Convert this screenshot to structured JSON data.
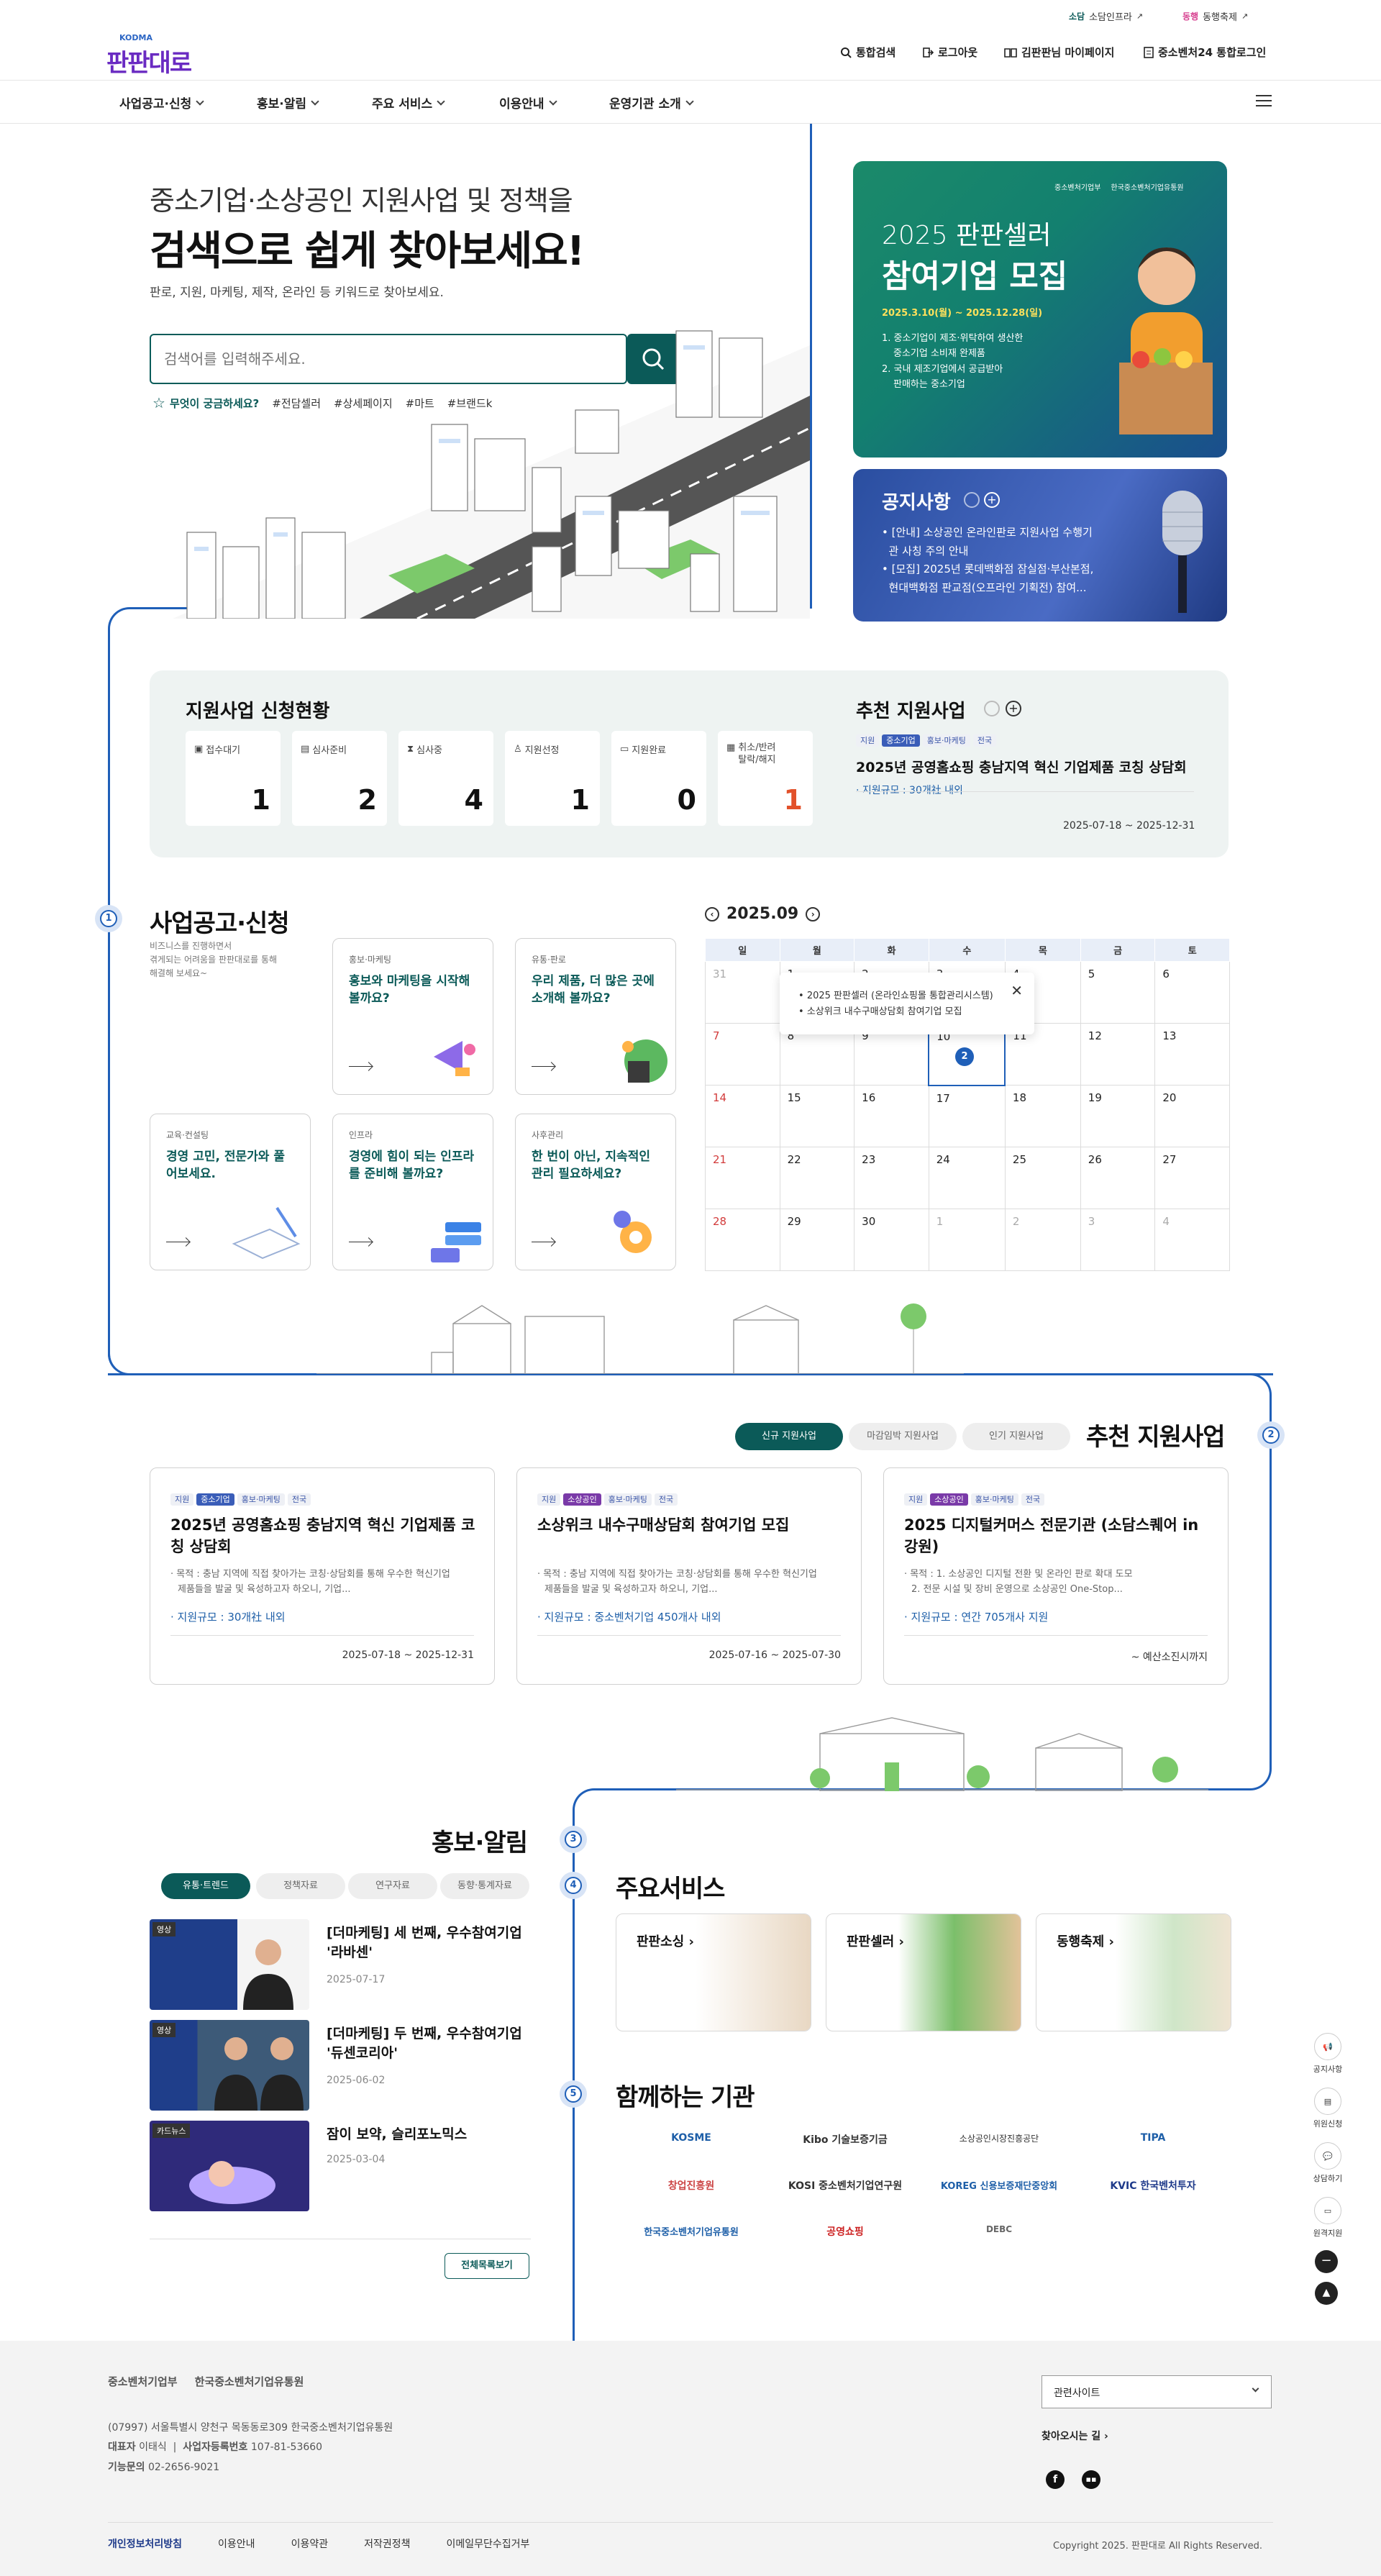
{
  "topbar": {
    "link1": "소담인프라",
    "link2": "동행축제"
  },
  "header": {
    "logo_top": "KODMA",
    "logo": "판판대로",
    "search": "통합검색",
    "logout": "로그아웃",
    "mypage": "김판판님 마이페이지",
    "login24": "중소벤처24 통합로그인"
  },
  "gnb": [
    "사업공고·신청",
    "홍보·알림",
    "주요 서비스",
    "이용안내",
    "운영기관 소개"
  ],
  "hero": {
    "sub": "중소기업·소상공인 지원사업 및 정책을",
    "title": "검색으로 쉽게 찾아보세요!",
    "desc": "판로, 지원, 마케팅, 제작, 온라인 등 키워드로 찾아보세요.",
    "placeholder": "검색어를 입력해주세요.",
    "question": "무엇이 궁금하세요?",
    "keywords": [
      "#전담셀러",
      "#상세페이지",
      "#마트",
      "#브랜드k"
    ]
  },
  "banner1": {
    "org1": "중소벤처기업부",
    "org2": "한국중소벤처기업유통원",
    "year": "2025 판판셀러",
    "title": "참여기업 모집",
    "date": "2025.3.10(월) ~ 2025.12.28(일)",
    "l1": "1. 중소기업이 제조·위탁하여 생산한",
    "l1b": "중소기업 소비재 완제품",
    "l2": "2. 국내 제조기업에서 공급받아",
    "l2b": "판매하는 중소기업"
  },
  "notice": {
    "title": "공지사항",
    "i1a": "[안내] 소상공인 온라인판로 지원사업 수행기",
    "i1b": "관 사칭 주의 안내",
    "i2a": "[모집] 2025년 롯데백화점 잠실점·부산본점,",
    "i2b": "현대백화점 판교점(오프라인 기획전) 참여..."
  },
  "status": {
    "title": "지원사업 신청현황",
    "items": [
      {
        "label": "접수대기",
        "value": "1"
      },
      {
        "label": "심사준비",
        "value": "2"
      },
      {
        "label": "심사중",
        "value": "4"
      },
      {
        "label": "지원선정",
        "value": "1"
      },
      {
        "label": "지원완료",
        "value": "0"
      },
      {
        "label": "취소/반려",
        "label2": "탈락/해지",
        "value": "1"
      }
    ]
  },
  "rec_small": {
    "title": "추천 지원사업",
    "tags": [
      "지원",
      "중소기업",
      "홍보·마케팅",
      "전국"
    ],
    "item": "2025년 공영홈쇼핑 충남지역 혁신 기업제품 코칭 상담회",
    "scale": "· 지원규모 : 30개社 내외",
    "date": "2025-07-18 ~ 2025-12-31"
  },
  "biz": {
    "title": "사업공고·신청",
    "desc1": "비즈니스를 진행하면서",
    "desc2": "겪게되는 어려움을 판판대로를 통해",
    "desc3": "해결해 보세요~",
    "cards": [
      {
        "cat": "홍보·마케팅",
        "title": "홍보와 마케팅을 시작해 볼까요?"
      },
      {
        "cat": "유통·판로",
        "title": "우리 제품, 더 많은 곳에 소개해 볼까요?"
      },
      {
        "cat": "교육·컨설팅",
        "title": "경영 고민, 전문가와 풀어보세요."
      },
      {
        "cat": "인프라",
        "title": "경영에 힘이 되는 인프라를 준비해 볼까요?"
      },
      {
        "cat": "사후관리",
        "title": "한 번이 아닌, 지속적인 관리 필요하세요?"
      }
    ]
  },
  "calendar": {
    "month": "2025.09",
    "days": [
      "일",
      "월",
      "화",
      "수",
      "목",
      "금",
      "토"
    ],
    "weeks": [
      [
        "31",
        "1",
        "2",
        "3",
        "4",
        "5",
        "6"
      ],
      [
        "7",
        "8",
        "9",
        "10",
        "11",
        "12",
        "13"
      ],
      [
        "14",
        "15",
        "16",
        "17",
        "18",
        "19",
        "20"
      ],
      [
        "21",
        "22",
        "23",
        "24",
        "25",
        "26",
        "27"
      ],
      [
        "28",
        "29",
        "30",
        "1",
        "2",
        "3",
        "4"
      ]
    ],
    "popup1": "2025 판판셀러 (온라인쇼핑몰 통합관리시스템)",
    "popup2": "소상위크 내수구매상담회 참여기업 모집",
    "badge": "2"
  },
  "recommend": {
    "title": "추천 지원사업",
    "tabs": [
      "신규 지원사업",
      "마감임박 지원사업",
      "인기 지원사업"
    ],
    "cards": [
      {
        "tags": [
          "지원",
          "중소기업",
          "홍보·마케팅",
          "전국"
        ],
        "title": "2025년 공영홈쇼핑 충남지역 혁신 기업제품 코칭 상담회",
        "d1": "· 목적 : 충남 지역에 직접 찾아가는 코칭·상담회를 통해 우수한 혁신기업",
        "d2": "제품들을 발굴 및 육성하고자 하오니, 기업...",
        "scale": "· 지원규모 : 30개社 내외",
        "date": "2025-07-18 ~ 2025-12-31"
      },
      {
        "tags": [
          "지원",
          "소상공인",
          "홍보·마케팅",
          "전국"
        ],
        "title": "소상위크 내수구매상담회 참여기업 모집",
        "d1": "· 목적 : 충남 지역에 직접 찾아가는 코칭·상담회를 통해 우수한 혁신기업",
        "d2": "제품들을 발굴 및 육성하고자 하오니, 기업...",
        "scale": "· 지원규모 : 중소벤처기업 450개사 내외",
        "date": "2025-07-16 ~ 2025-07-30"
      },
      {
        "tags": [
          "지원",
          "소상공인",
          "홍보·마케팅",
          "전국"
        ],
        "title": "2025 디지털커머스 전문기관 (소담스퀘어 in 강원)",
        "d1": "· 목적 : 1. 소상공인 디지털 전환 및 온라인 판로 확대 도모",
        "d2": "2. 전문 시설 및 장비 운영으로 소상공인 One-Stop...",
        "scale": "· 지원규모 : 연간 705개사 지원",
        "date": "~ 예산소진시까지"
      }
    ]
  },
  "promo": {
    "title": "홍보·알림",
    "tabs": [
      "유통·트렌드",
      "정책자료",
      "연구자료",
      "동향·통계자료"
    ],
    "items": [
      {
        "badge": "영상",
        "title1": "[더마케팅] 세 번째, 우수참여기업",
        "title2": "'라바센'",
        "date": "2025-07-17"
      },
      {
        "badge": "영상",
        "title1": "[더마케팅] 두 번째, 우수참여기업",
        "title2": "'듀센코리아'",
        "date": "2025-06-02"
      },
      {
        "badge": "카드뉴스",
        "title1": "잠이 보약, 슬리포노믹스",
        "title2": "",
        "date": "2025-03-04"
      }
    ],
    "more": "전체목록보기"
  },
  "services": {
    "title": "주요서비스",
    "items": [
      "판판소싱",
      "판판셀러",
      "동행축제"
    ]
  },
  "partners": {
    "title": "함께하는 기관",
    "orgs": [
      "KOSME",
      "Kibo 기술보증기금",
      "소상공인시장진흥공단",
      "TIPA",
      "창업진흥원",
      "KOSI 중소벤처기업연구원",
      "KOREG 신용보증재단중앙회",
      "KVIC 한국벤처투자",
      "한국중소벤처기업유통원",
      "공영쇼핑",
      "DEBC"
    ]
  },
  "quick": [
    "공지사항",
    "위원신청",
    "상담하기",
    "원격지원"
  ],
  "steps": [
    "1",
    "2",
    "3",
    "4",
    "5"
  ],
  "footer": {
    "org1": "중소벤처기업부",
    "org2": "한국중소벤처기업유통원",
    "addr": "(07997) 서울특별시 양천구 목동동로309 한국중소벤처기업유통원",
    "ceo_label": "대표자",
    "ceo": "이태식",
    "biz_label": "사업자등록번호",
    "biz": "107-81-53660",
    "tel_label": "기능문의",
    "tel": "02-2656-9021",
    "related": "관련사이트",
    "way": "찾아오시는 길",
    "links": [
      "개인정보처리방침",
      "이용안내",
      "이용약관",
      "저작권정책",
      "이메일무단수집거부"
    ],
    "copy": "Copyright 2025. 판판대로 All Rights Reserved."
  }
}
